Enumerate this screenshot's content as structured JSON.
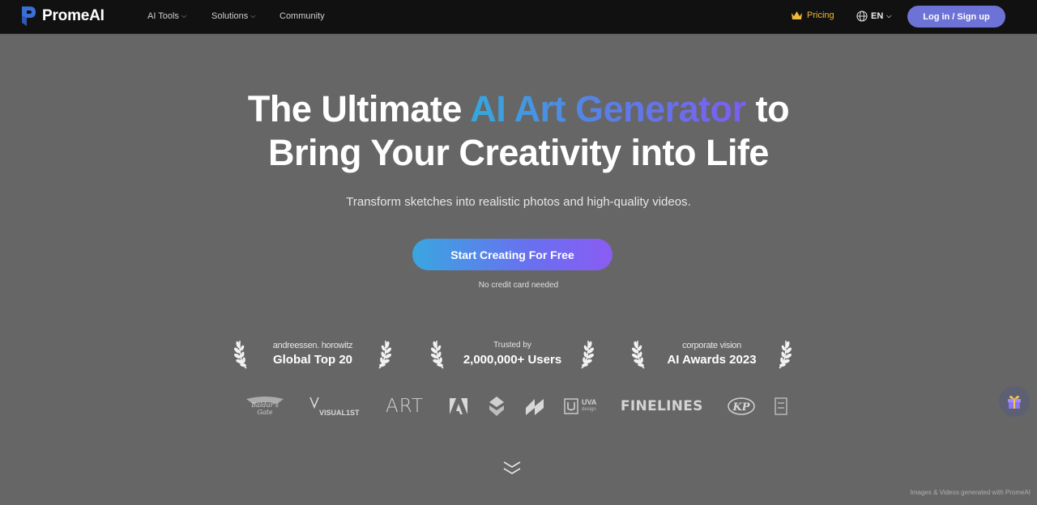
{
  "nav": {
    "logo_text": "PromeAI",
    "items": [
      {
        "label": "AI Tools",
        "has_dropdown": true
      },
      {
        "label": "Solutions",
        "has_dropdown": true
      },
      {
        "label": "Community",
        "has_dropdown": false
      }
    ],
    "pricing": {
      "label": "Pricing",
      "icon": "crown-icon",
      "color": "#f0b93a"
    },
    "language": {
      "label": "EN",
      "icon": "globe-icon"
    },
    "login_label": "Log in / Sign up"
  },
  "hero": {
    "title_part1": "The Ultimate ",
    "title_highlight": "AI Art Generator",
    "title_part2": " to",
    "title_line2": "Bring Your Creativity into Life",
    "subtitle": "Transform sketches into realistic photos and high-quality videos.",
    "cta_label": "Start Creating For Free",
    "cta_note": "No credit card needed"
  },
  "awards": [
    {
      "top": "andreessen. horowitz",
      "main": "Global Top 20"
    },
    {
      "top": "Trusted by",
      "main": "2,000,000+ Users"
    },
    {
      "top": "corporate vision",
      "main": "AI Awards 2023"
    }
  ],
  "partners": [
    {
      "name": "baldurs-gate",
      "label": "Baldur's Gate"
    },
    {
      "name": "visual1st",
      "label": "VISUAL1ST"
    },
    {
      "name": "art",
      "label": "ART"
    },
    {
      "name": "adobe",
      "label": "A"
    },
    {
      "name": "unknown-mark",
      "label": ""
    },
    {
      "name": "slant-mark",
      "label": ""
    },
    {
      "name": "uva-design",
      "label": "UVA",
      "sub": "design"
    },
    {
      "name": "finelines",
      "label": "FINELINES"
    },
    {
      "name": "kp",
      "label": "KP"
    }
  ],
  "footer_credit": "Images & Videos generated with PromeAI",
  "colors": {
    "background": "#666666",
    "nav_bg": "#111111",
    "accent": "#6d72d6",
    "gradient_start": "#34a8de",
    "gradient_end": "#7b5ef0"
  }
}
